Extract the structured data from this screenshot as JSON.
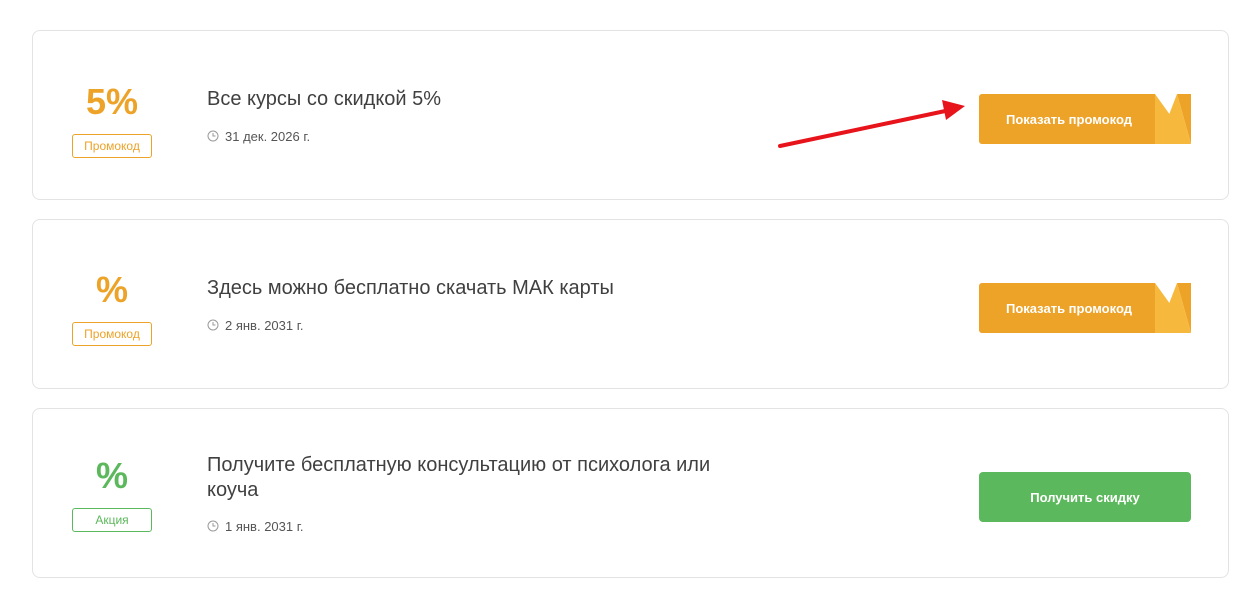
{
  "offers": [
    {
      "amount": "5%",
      "badge": "Промокод",
      "title": "Все курсы со скидкой 5%",
      "date": "31 дек. 2026 г.",
      "button": "Показать промокод",
      "color": "#eda228"
    },
    {
      "amount": "%",
      "badge": "Промокод",
      "title": "Здесь можно бесплатно скачать МАК карты",
      "date": "2 янв. 2031 г.",
      "button": "Показать промокод",
      "color": "#eda228"
    },
    {
      "amount": "%",
      "badge": "Акция",
      "title": "Получите бесплатную консультацию от психолога или коуча",
      "date": "1 янв. 2031 г.",
      "button": "Получить скидку",
      "color": "#5cb85c"
    }
  ],
  "annotation": {
    "arrow_color": "#e8141b"
  },
  "icons": {
    "date": "clock-icon",
    "annotation": "red-arrow"
  }
}
